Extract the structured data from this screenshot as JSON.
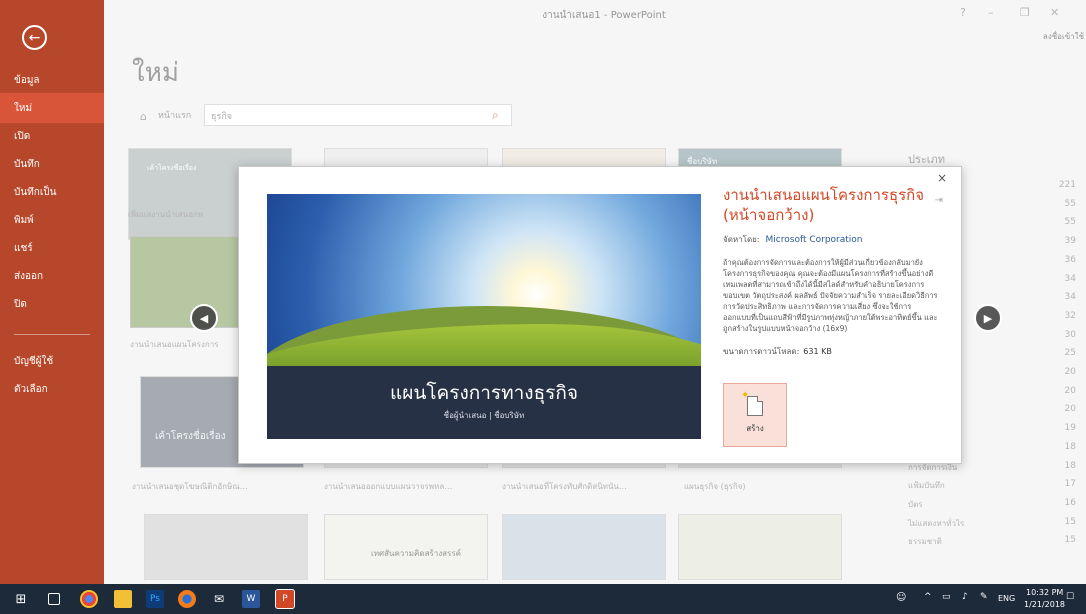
{
  "window": {
    "title": "งานนำเสนอ1 - PowerPoint",
    "signin": "ลงชื่อเข้าใช้",
    "help": "?",
    "minimize": "–",
    "restore": "❐",
    "close": "✕"
  },
  "nav": {
    "back": "←",
    "items": [
      "ข้อมูล",
      "ใหม่",
      "เปิด",
      "บันทึก",
      "บันทึกเป็น",
      "พิมพ์",
      "แชร์",
      "ส่งออก",
      "ปิด",
      "บัญชีผู้ใช้",
      "ตัวเลือก"
    ]
  },
  "main": {
    "heading": "ใหม่",
    "home_label": "หน้าแรก",
    "search_value": "ธุรกิจ",
    "thumb_labels": [
      "เพิ่มแลงานนำเสนอกพ",
      "งานนำเสนอแผนโครงการ",
      "งานนำเสนอชุดโฆษณิติกอักษิณ…",
      "งานนำเสนอออกแบบแผนวาจรพหล…",
      "งานนำเสนอที่โครงทับศักดิสนิทนัน…",
      "แผนธุรกิจ (ธุรกิจ)"
    ],
    "thumb_texts": [
      "เค้าโครงชื่อเรื่อง",
      "เค้าโครงชื่อเรื่อง",
      "ชื่อบริษัท",
      "เค้าโครงชื่อเรื่อง",
      "เทศสันความคิดสร้างสรรค์"
    ],
    "categories": {
      "heading": "ประเภท",
      "rows": [
        {
          "name": "",
          "count": "221"
        },
        {
          "name": "",
          "count": "55"
        },
        {
          "name": "",
          "count": "55"
        },
        {
          "name": "แบบ",
          "count": "39"
        },
        {
          "name": "",
          "count": "36"
        },
        {
          "name": "",
          "count": "34"
        },
        {
          "name": "",
          "count": "34"
        },
        {
          "name": "",
          "count": "32"
        },
        {
          "name": "งาน",
          "count": "30"
        },
        {
          "name": "",
          "count": "25"
        },
        {
          "name": "",
          "count": "20"
        },
        {
          "name": "",
          "count": "20"
        },
        {
          "name": "",
          "count": "20"
        },
        {
          "name": "",
          "count": "19"
        },
        {
          "name": "",
          "count": "18"
        },
        {
          "name": "การจัดการเงิน",
          "count": "18"
        },
        {
          "name": "แฟ้มบันทึก",
          "count": "17"
        },
        {
          "name": "บัตร",
          "count": "16"
        },
        {
          "name": "ไม่แสดงหาทั่วไร",
          "count": "15"
        },
        {
          "name": "ธรรมชาติ",
          "count": "15"
        }
      ]
    }
  },
  "modal": {
    "close": "×",
    "pin": "⇥",
    "title": "งานนำเสนอแผนโครงการธุรกิจ (หน้าจอกว้าง)",
    "provider_label": "จัดหาโดย:",
    "provider": "Microsoft Corporation",
    "description": "ถ้าคุณต้องการจัดการและต้องการให้ผู้มีส่วนเกี่ยวข้องกลับมายังโครงการธุรกิจของคุณ คุณจะต้องมีแผนโครงการที่สร้างขึ้นอย่างดี เทมเพลตที่สามารถเข้าถึงได้นี้มีสไลด์สำหรับคำอธิบายโครงการ ขอบเขต วัตถุประสงค์ ผลลัพธ์ ปัจจัยความสำเร็จ รายละเอียดวิธีการ การวัดประสิทธิภาพ และการจัดการความเสี่ยง ซึ่งจะใช้การออกแบบที่เป็นแถบสีฟ้าที่มีรูปภาพทุ่งหญ้าภายใต้พระอาทิตย์ขึ้น และถูกสร้างในรูปแบบหน้าจอกว้าง (16x9)",
    "download_label": "ขนาดการดาวน์โหลด:",
    "download_size": "631 KB",
    "create_label": "สร้าง",
    "preview_title": "แผนโครงการทางธุรกิจ",
    "preview_subtitle": "ชื่อผู้นำเสนอ | ชื่อบริษัท"
  },
  "taskbar": {
    "time": "10:32 PM",
    "date": "1/21/2018",
    "lang": "ENG"
  }
}
